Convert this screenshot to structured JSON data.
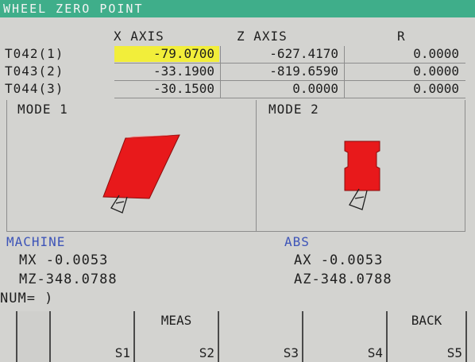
{
  "title": "WHEEL ZERO POINT",
  "columns": {
    "x": "X AXIS",
    "z": "Z AXIS",
    "r": "R"
  },
  "rows": [
    {
      "label": "T042(1)",
      "x": "-79.0700",
      "z": "-627.4170",
      "r": "0.0000"
    },
    {
      "label": "T043(2)",
      "x": "-33.1900",
      "z": "-819.6590",
      "r": "0.0000"
    },
    {
      "label": "T044(3)",
      "x": "-30.1500",
      "z": "0.0000",
      "r": "0.0000"
    }
  ],
  "modes": {
    "mode1": "MODE 1",
    "mode2": "MODE 2"
  },
  "machine": {
    "label": "MACHINE",
    "mx": "MX -0.0053",
    "mz": "MZ-348.0788"
  },
  "abs": {
    "label": "ABS",
    "ax": "AX -0.0053",
    "az": "AZ-348.0788"
  },
  "input": "NUM= )",
  "softkeys": [
    {
      "top": "",
      "bottom": "S1"
    },
    {
      "top": "MEAS",
      "bottom": "S2"
    },
    {
      "top": "",
      "bottom": "S3"
    },
    {
      "top": "",
      "bottom": "S4"
    },
    {
      "top": "BACK",
      "bottom": "S5"
    }
  ],
  "colors": {
    "title_bar": "#3fae8a",
    "selected_cell": "#f2ee3a",
    "section_label": "#3d54b8",
    "shape_fill": "#e8191b"
  }
}
